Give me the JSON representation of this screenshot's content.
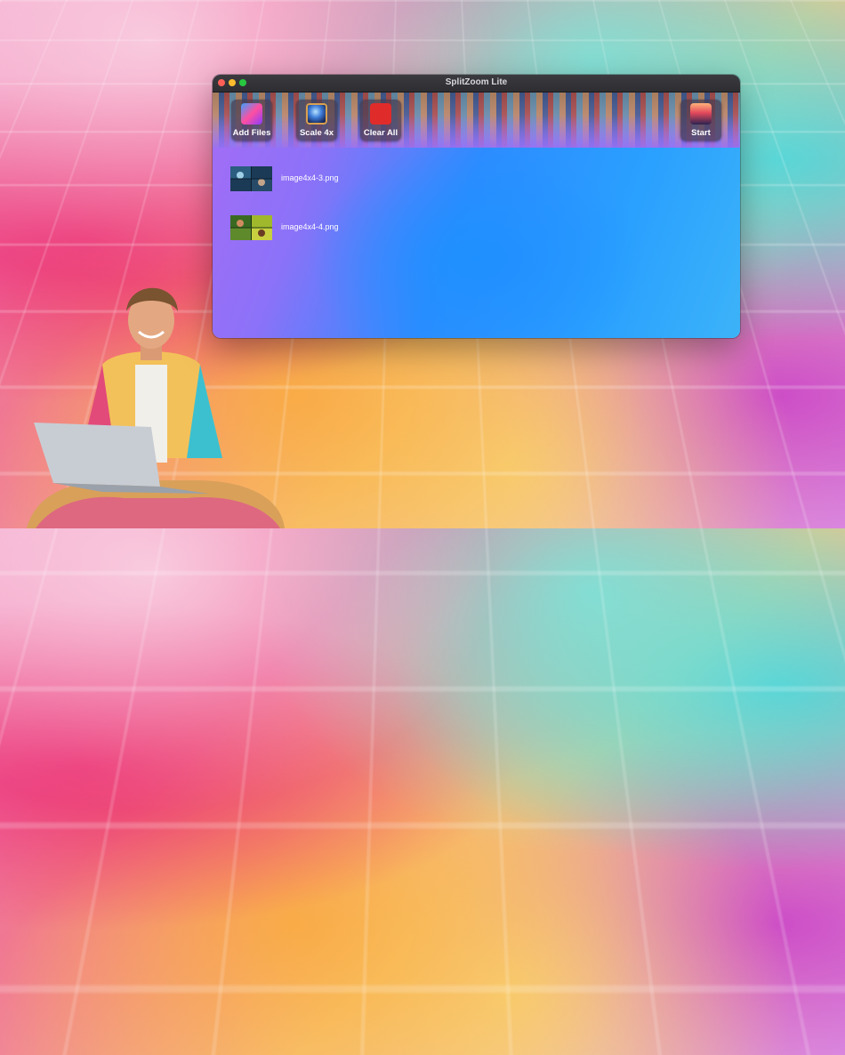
{
  "window": {
    "title": "SplitZoom Lite"
  },
  "toolbar": {
    "add_files": "Add Files",
    "scale": "Scale 4x",
    "clear_all": "Clear All",
    "start": "Start"
  },
  "files": [
    {
      "name": "image4x4-3.png"
    },
    {
      "name": "image4x4-4.png"
    }
  ],
  "colors": {
    "window_gradient_start": "#a66cf6",
    "window_gradient_mid": "#2d8cff",
    "window_gradient_end": "#3cb3f8",
    "close": "#ff5f57",
    "minimize": "#febc2e",
    "zoom": "#28c840"
  }
}
